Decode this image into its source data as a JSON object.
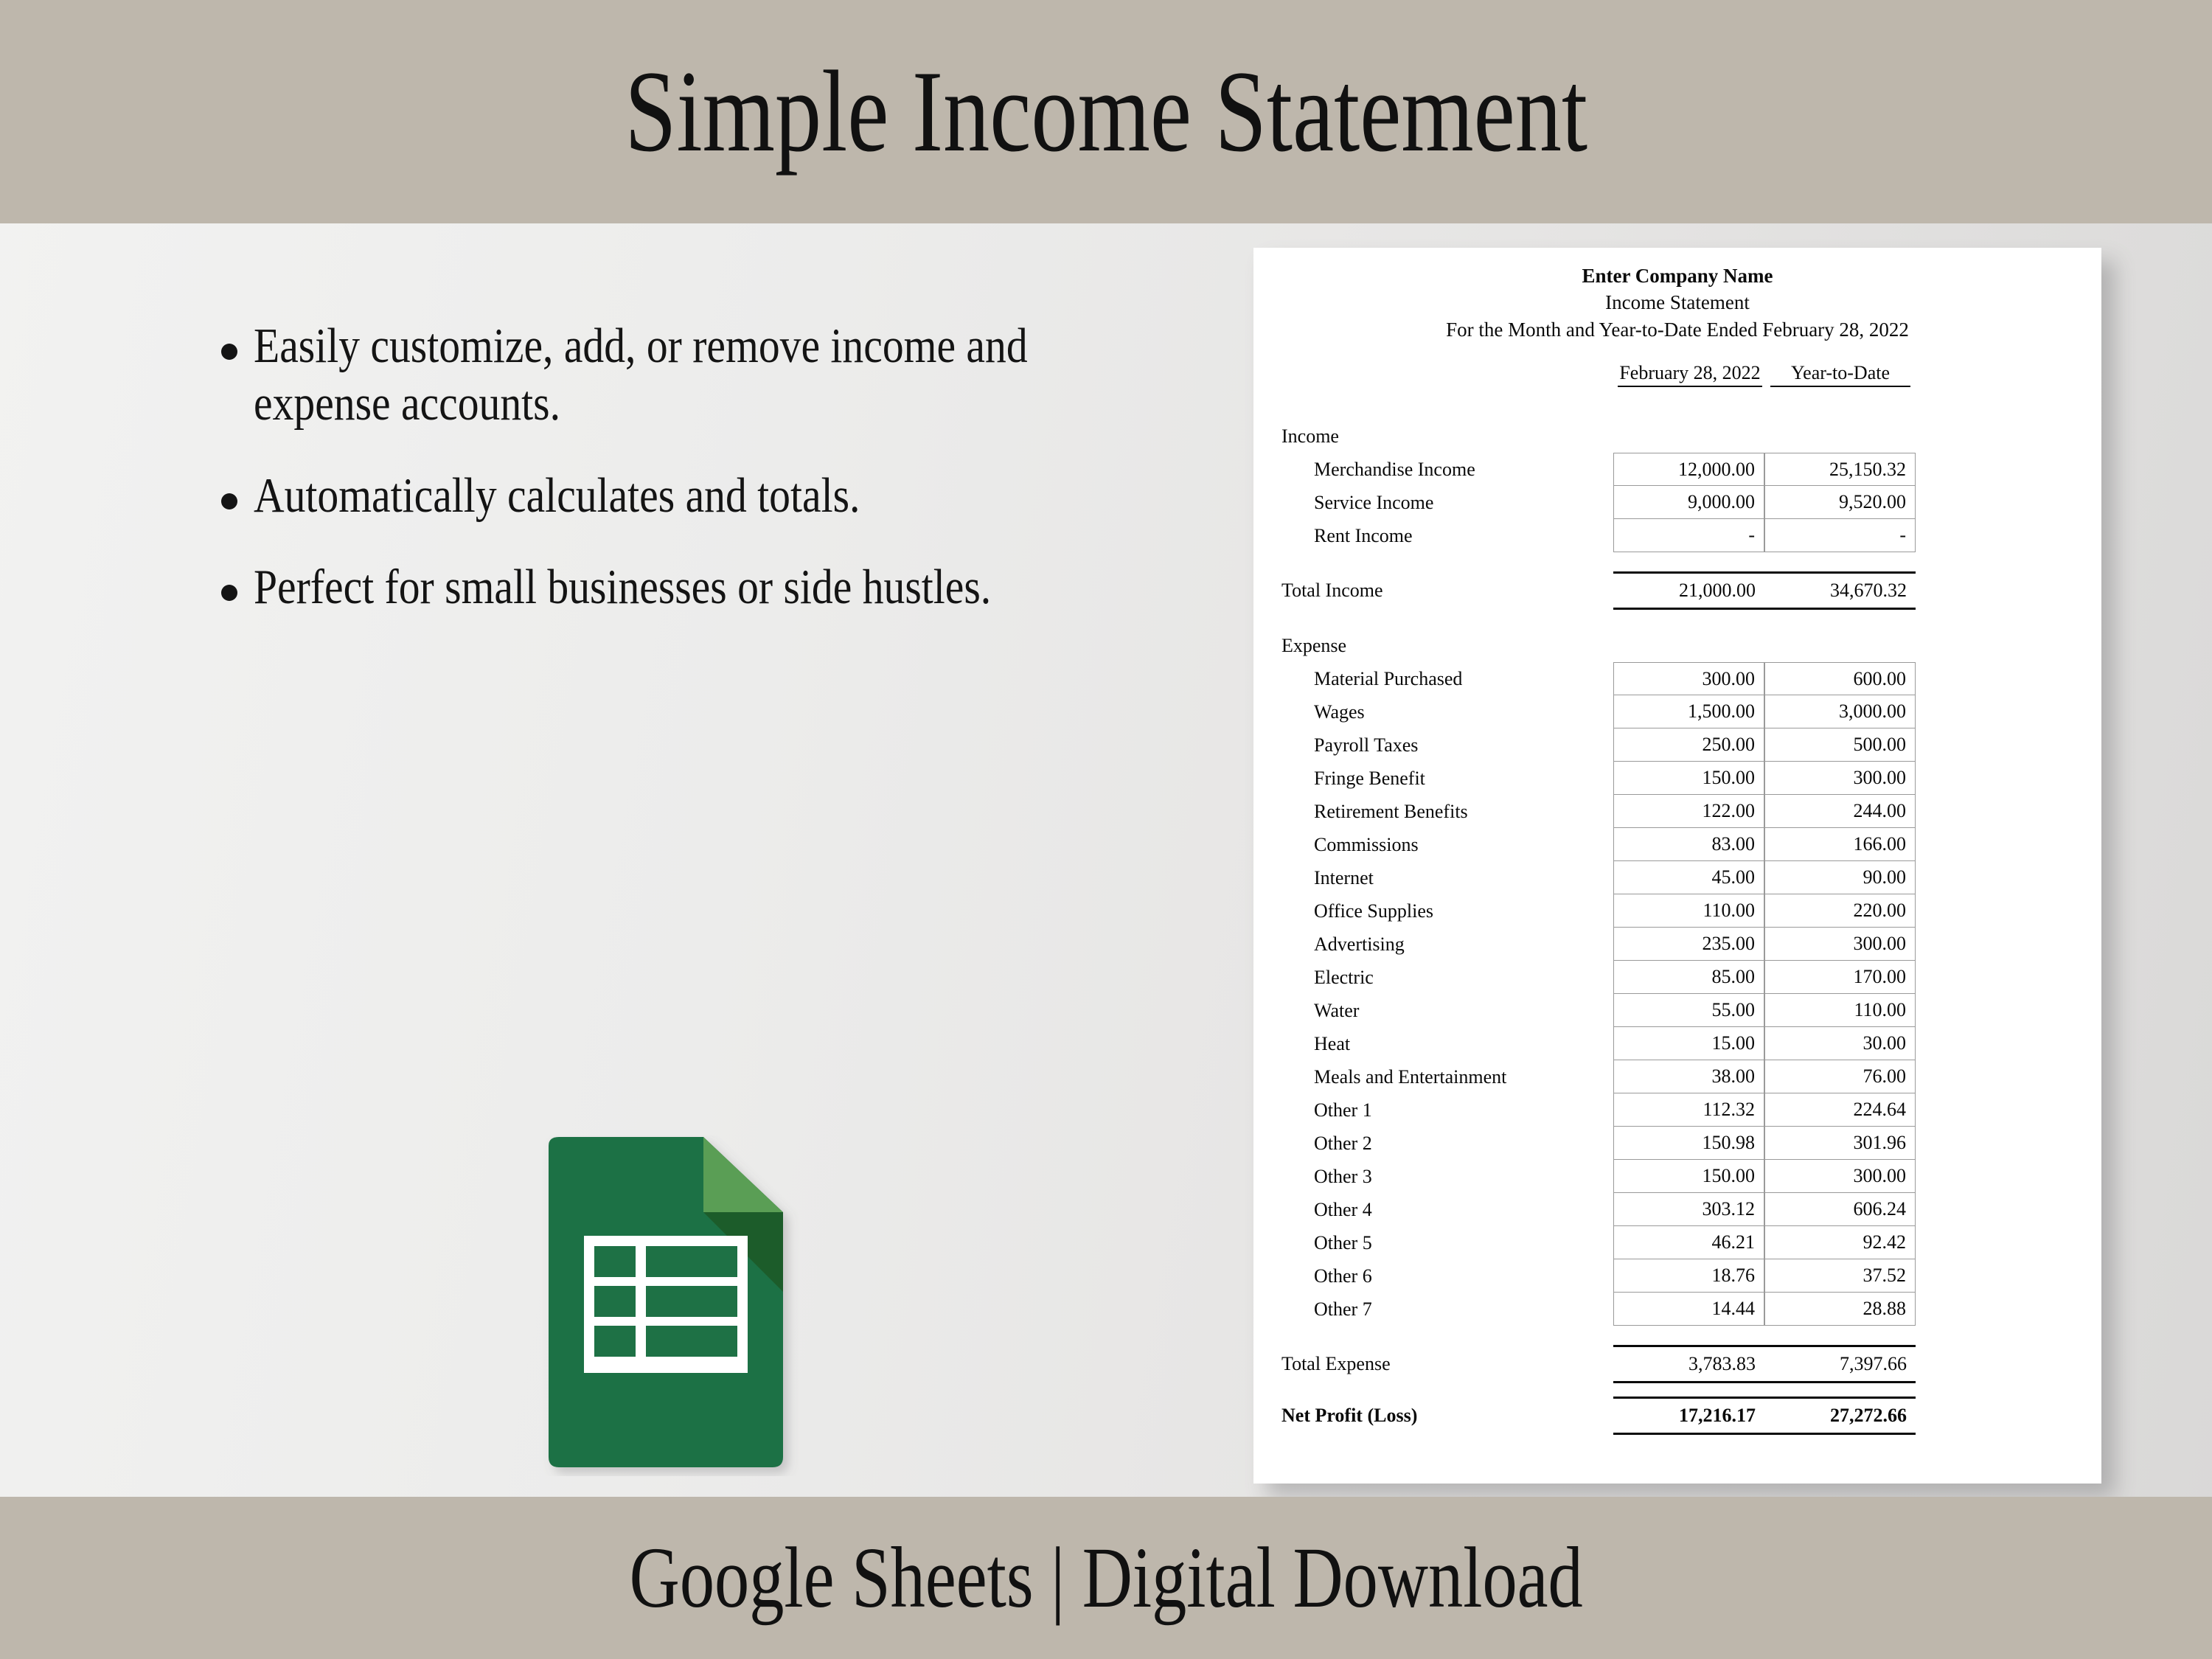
{
  "header": {
    "title": "Simple Income Statement"
  },
  "footer": {
    "title": "Google Sheets | Digital Download"
  },
  "features": {
    "items": [
      "Easily customize, add, or remove income and expense accounts.",
      "Automatically calculates and totals.",
      "Perfect for small businesses or side hustles."
    ]
  },
  "logo": {
    "name": "google-sheets-icon",
    "colors": {
      "body": "#1e7145",
      "fold_light": "#5a9e55",
      "fold_shadow": "#1a5c2b",
      "grid": "#ffffff"
    }
  },
  "document": {
    "company": "Enter Company Name",
    "statement_title": "Income Statement",
    "period": "For the Month and Year-to-Date Ended February 28, 2022",
    "columns": [
      "February 28, 2022",
      "Year-to-Date"
    ],
    "income_section_label": "Income",
    "income_rows": [
      {
        "label": "Merchandise Income",
        "month": "12,000.00",
        "ytd": "25,150.32"
      },
      {
        "label": "Service Income",
        "month": "9,000.00",
        "ytd": "9,520.00"
      },
      {
        "label": "Rent Income",
        "month": "-",
        "ytd": "-"
      }
    ],
    "total_income": {
      "label": "Total Income",
      "month": "21,000.00",
      "ytd": "34,670.32"
    },
    "expense_section_label": "Expense",
    "expense_rows": [
      {
        "label": "Material Purchased",
        "month": "300.00",
        "ytd": "600.00"
      },
      {
        "label": "Wages",
        "month": "1,500.00",
        "ytd": "3,000.00"
      },
      {
        "label": "Payroll Taxes",
        "month": "250.00",
        "ytd": "500.00"
      },
      {
        "label": "Fringe Benefit",
        "month": "150.00",
        "ytd": "300.00"
      },
      {
        "label": "Retirement Benefits",
        "month": "122.00",
        "ytd": "244.00"
      },
      {
        "label": "Commissions",
        "month": "83.00",
        "ytd": "166.00"
      },
      {
        "label": "Internet",
        "month": "45.00",
        "ytd": "90.00"
      },
      {
        "label": "Office Supplies",
        "month": "110.00",
        "ytd": "220.00"
      },
      {
        "label": "Advertising",
        "month": "235.00",
        "ytd": "300.00"
      },
      {
        "label": "Electric",
        "month": "85.00",
        "ytd": "170.00"
      },
      {
        "label": "Water",
        "month": "55.00",
        "ytd": "110.00"
      },
      {
        "label": "Heat",
        "month": "15.00",
        "ytd": "30.00"
      },
      {
        "label": "Meals and Entertainment",
        "month": "38.00",
        "ytd": "76.00"
      },
      {
        "label": "Other 1",
        "month": "112.32",
        "ytd": "224.64"
      },
      {
        "label": "Other 2",
        "month": "150.98",
        "ytd": "301.96"
      },
      {
        "label": "Other 3",
        "month": "150.00",
        "ytd": "300.00"
      },
      {
        "label": "Other 4",
        "month": "303.12",
        "ytd": "606.24"
      },
      {
        "label": "Other 5",
        "month": "46.21",
        "ytd": "92.42"
      },
      {
        "label": "Other 6",
        "month": "18.76",
        "ytd": "37.52"
      },
      {
        "label": "Other 7",
        "month": "14.44",
        "ytd": "28.88"
      }
    ],
    "total_expense": {
      "label": "Total Expense",
      "month": "3,783.83",
      "ytd": "7,397.66"
    },
    "net_profit": {
      "label": "Net Profit (Loss)",
      "month": "17,216.17",
      "ytd": "27,272.66"
    }
  },
  "theme": {
    "band_color": "#beb7ac",
    "text_color": "#141414",
    "card_bg": "#ffffff"
  }
}
